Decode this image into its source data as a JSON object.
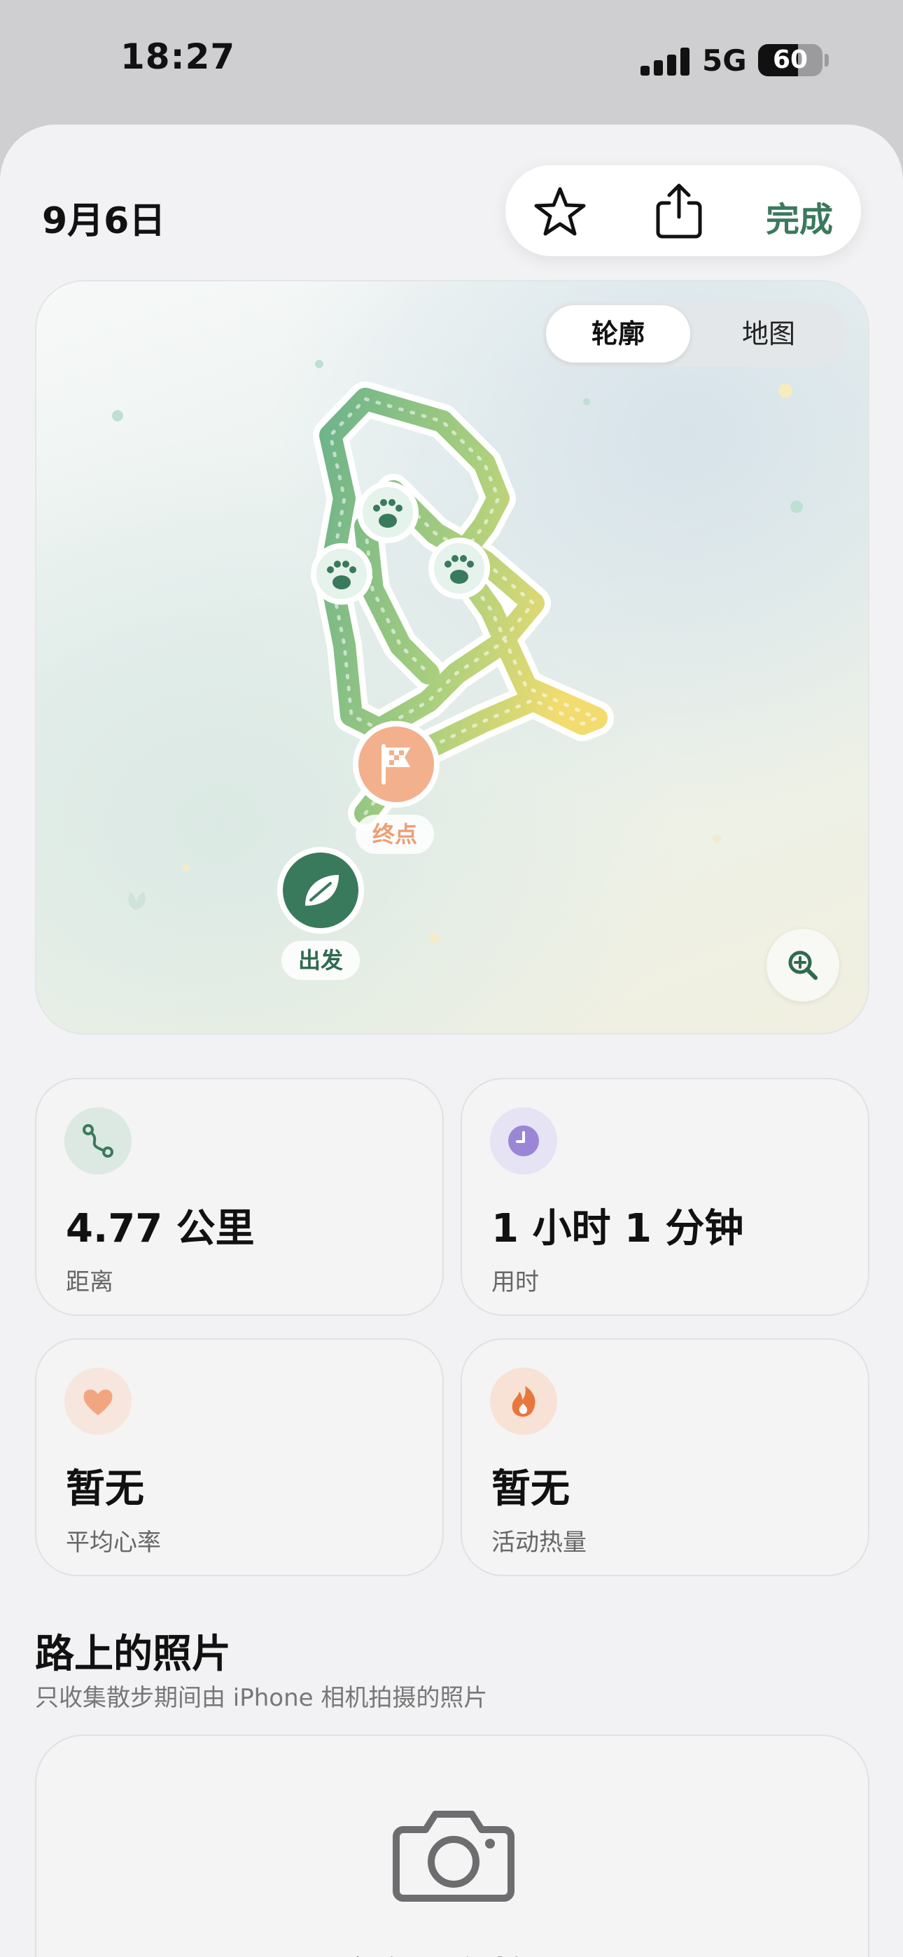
{
  "status_bar": {
    "time": "18:27",
    "network": "5G",
    "battery": "60"
  },
  "header": {
    "date": "9月6日",
    "done_label": "完成"
  },
  "map": {
    "segment": [
      "轮廓",
      "地图"
    ],
    "start_label": "出发",
    "end_label": "终点"
  },
  "stats": [
    {
      "value": "4.77 公里",
      "label": "距离"
    },
    {
      "value": "1 小时 1 分钟",
      "label": "用时"
    },
    {
      "value": "暂无",
      "label": "平均心率"
    },
    {
      "value": "暂无",
      "label": "活动热量"
    }
  ],
  "photos": {
    "title": "路上的照片",
    "subtitle": "只收集散步期间由 iPhone 相机拍摄的照片",
    "empty_text": "这次没有拍照"
  },
  "colors": {
    "accent": "#3a7a5c",
    "end_pin": "#f2b08d",
    "start_pin": "#3a7a5c"
  }
}
